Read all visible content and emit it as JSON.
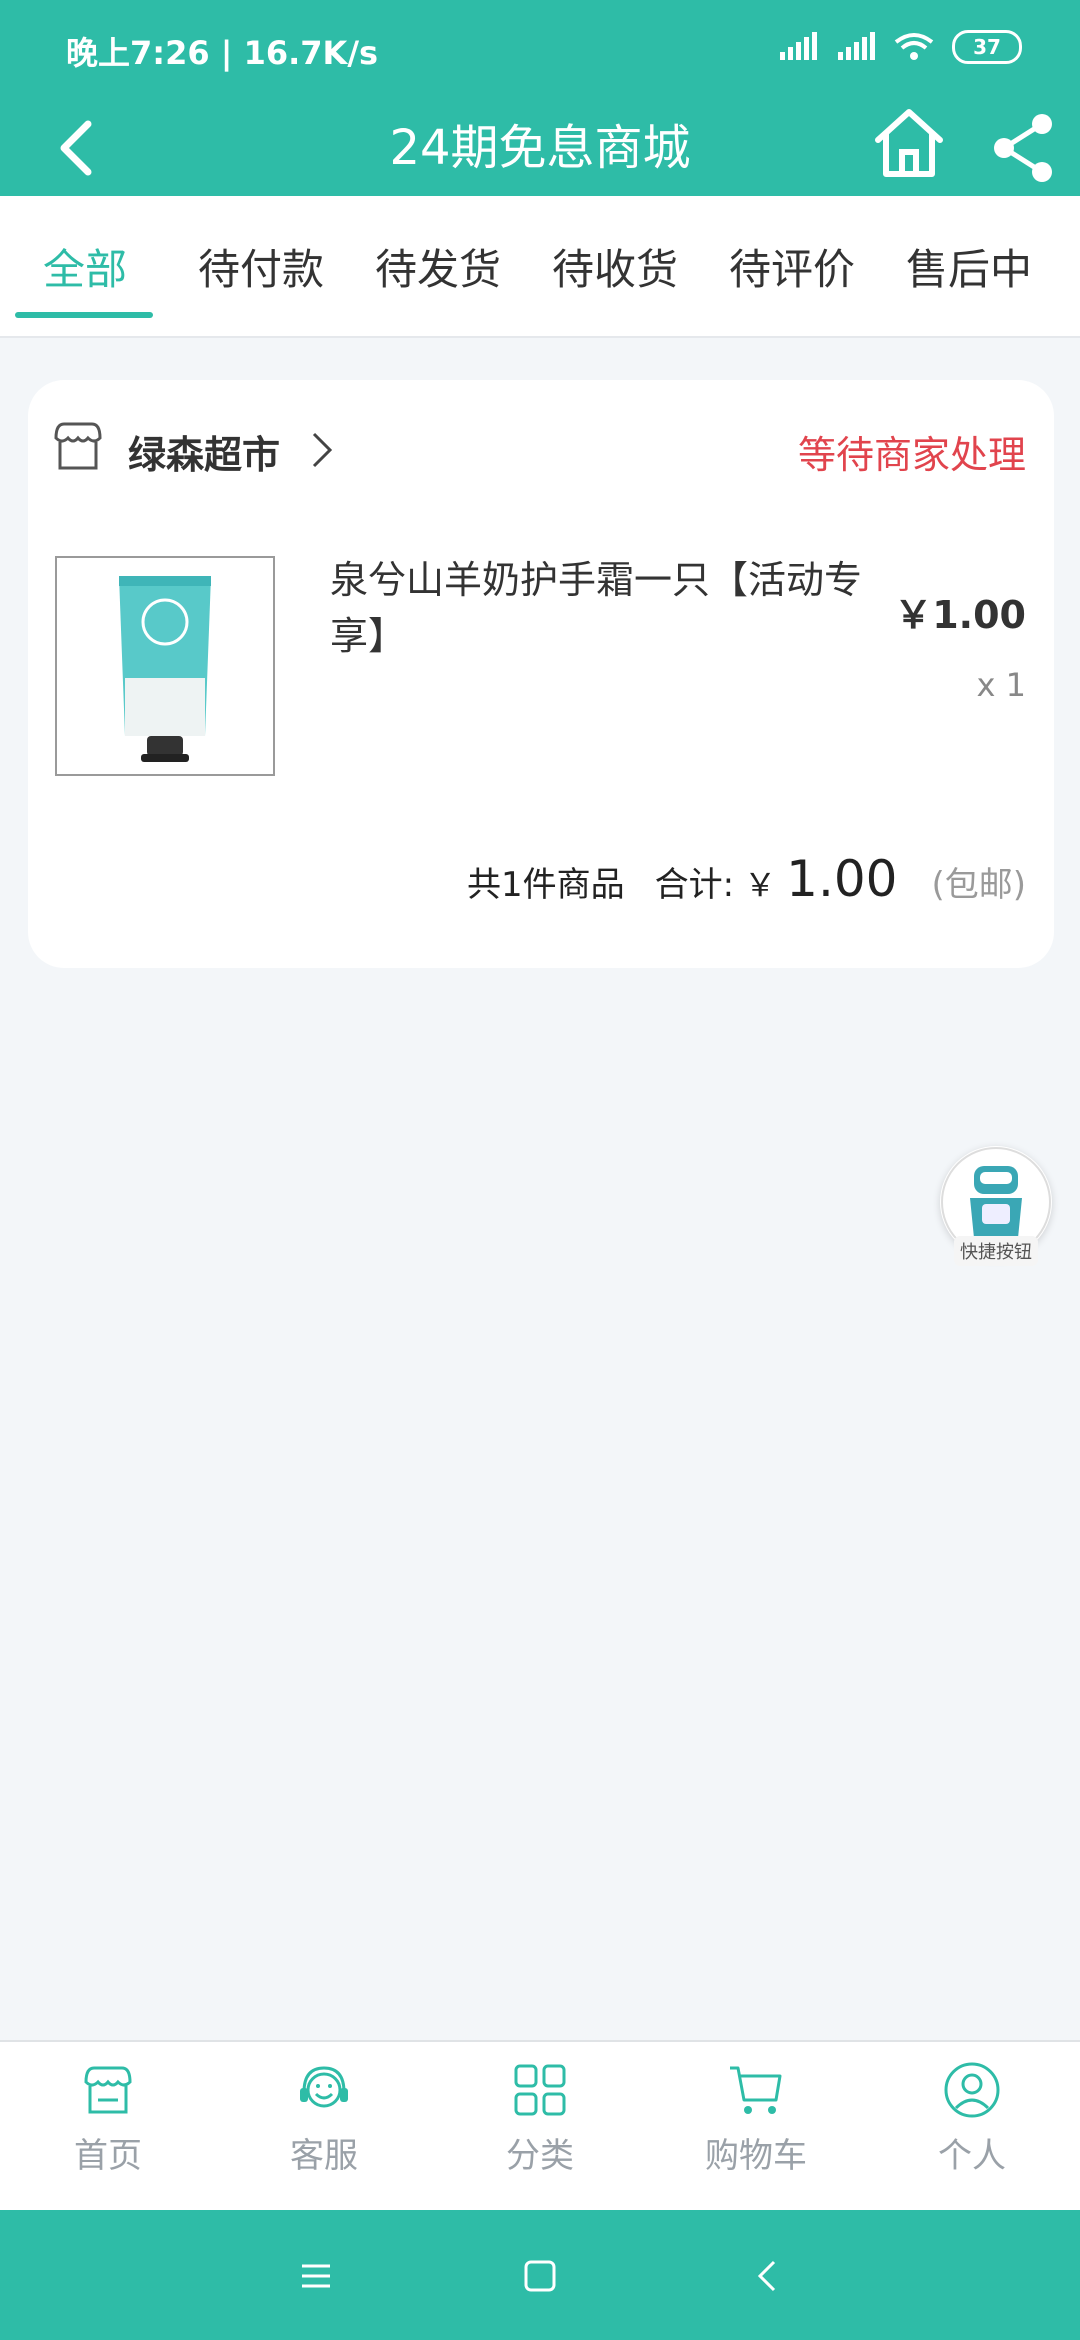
{
  "status_bar": {
    "time": "晚上7:26 | 16.7K/s",
    "battery": "37"
  },
  "app_bar": {
    "title": "24期免息商城",
    "icons": [
      "back-icon",
      "home-icon",
      "share-icon"
    ]
  },
  "tabs": [
    {
      "label": "全部",
      "active": true
    },
    {
      "label": "待付款"
    },
    {
      "label": "待发货"
    },
    {
      "label": "待收货"
    },
    {
      "label": "待评价"
    },
    {
      "label": "售后中"
    }
  ],
  "order": {
    "shop_name": "绿森超市",
    "status": "等待商家处理",
    "product": {
      "name": "泉兮山羊奶护手霜一只【活动专享】",
      "price": "￥1.00",
      "qty": "x 1"
    },
    "summary": {
      "count": "共1件商品",
      "total_label": "合计:",
      "currency": "￥",
      "total": "1.00",
      "shipping": "(包邮)"
    }
  },
  "quick_button": {
    "label": "快捷按钮"
  },
  "bottom_nav": [
    {
      "label": "首页",
      "icon": "store-icon"
    },
    {
      "label": "客服",
      "icon": "headset-icon"
    },
    {
      "label": "分类",
      "icon": "grid-icon"
    },
    {
      "label": "购物车",
      "icon": "cart-icon"
    },
    {
      "label": "个人",
      "icon": "user-icon"
    }
  ],
  "colors": {
    "accent": "#2ebca7",
    "status_red": "#e1444d",
    "background": "#f3f6f9"
  }
}
